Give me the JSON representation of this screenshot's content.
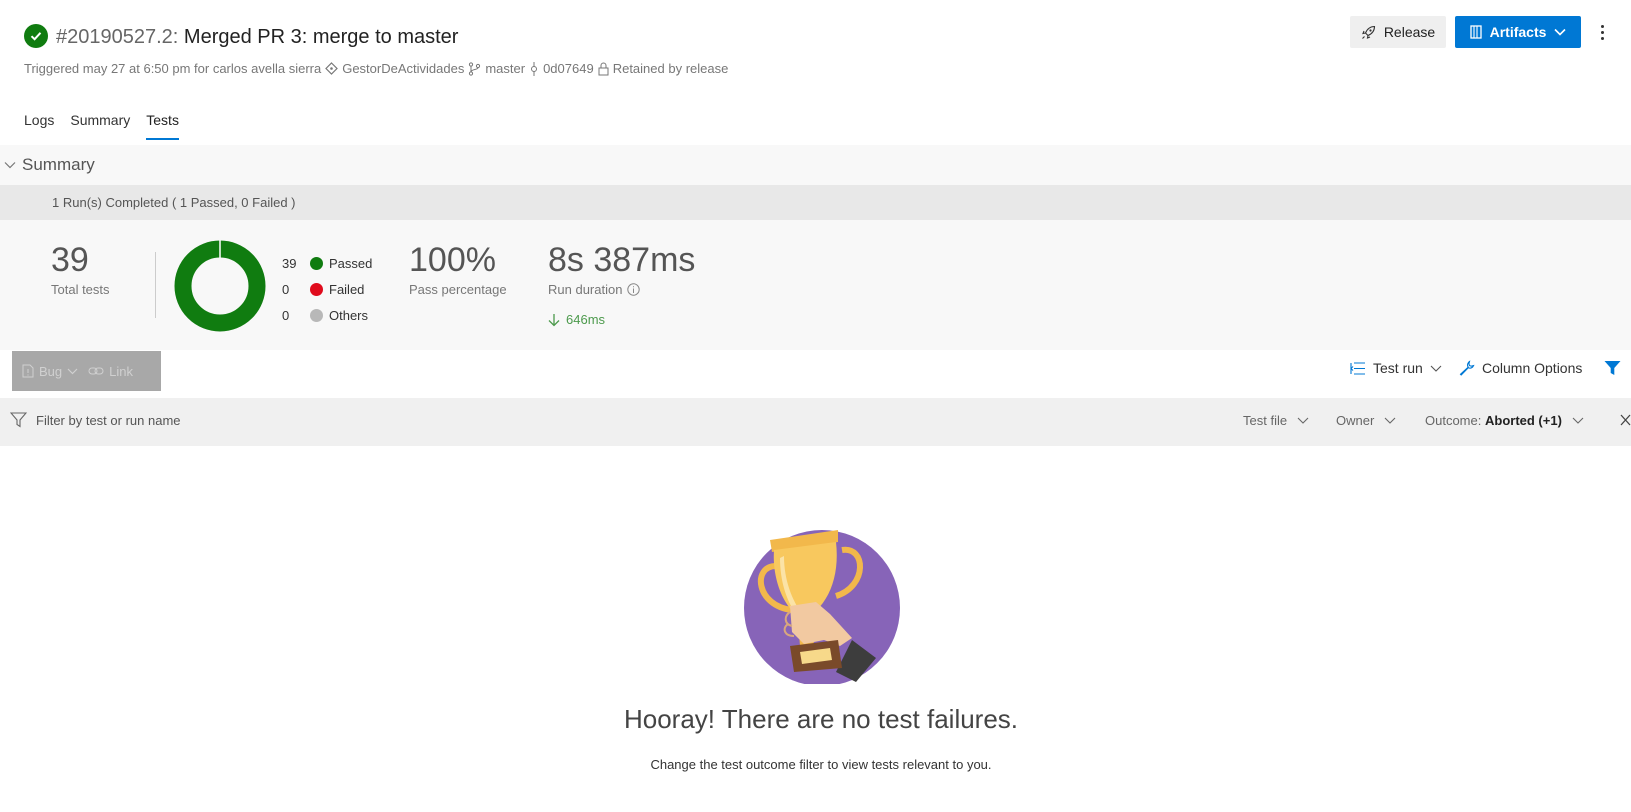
{
  "header": {
    "build_number": "#20190527.2:",
    "build_title": "Merged PR 3: merge to master",
    "triggered": "Triggered may 27 at 6:50 pm for carlos avella sierra",
    "repo": "GestorDeActividades",
    "branch": "master",
    "commit": "0d07649",
    "retention": "Retained by release",
    "release_label": "Release",
    "artifacts_label": "Artifacts"
  },
  "tabs": [
    {
      "label": "Logs",
      "active": false
    },
    {
      "label": "Summary",
      "active": false
    },
    {
      "label": "Tests",
      "active": true
    }
  ],
  "summary": {
    "section_title": "Summary",
    "runs_completed": "1 Run(s) Completed ( 1 Passed, 0 Failed )",
    "total_tests": "39",
    "total_tests_label": "Total tests",
    "legend": [
      {
        "count": "39",
        "label": "Passed",
        "color": "#107c10"
      },
      {
        "count": "0",
        "label": "Failed",
        "color": "#e00b1c"
      },
      {
        "count": "0",
        "label": "Others",
        "color": "#b8b8b8"
      }
    ],
    "pass_percentage": "100%",
    "pass_percentage_label": "Pass percentage",
    "run_duration": "8s 387ms",
    "run_duration_label": "Run duration",
    "duration_delta": "646ms"
  },
  "toolbar": {
    "bug_label": "Bug",
    "link_label": "Link",
    "test_run_label": "Test run",
    "column_options_label": "Column Options"
  },
  "filter": {
    "placeholder": "Filter by test or run name",
    "test_file_label": "Test file",
    "owner_label": "Owner",
    "outcome_label": "Outcome:",
    "outcome_value": "Aborted (+1)"
  },
  "empty_state": {
    "headline": "Hooray! There are no test failures.",
    "hint": "Change the test outcome filter to view tests relevant to you."
  },
  "colors": {
    "accent": "#0078d4",
    "success": "#107c10",
    "failure": "#e00b1c",
    "trophy_bg": "#8764b8"
  }
}
